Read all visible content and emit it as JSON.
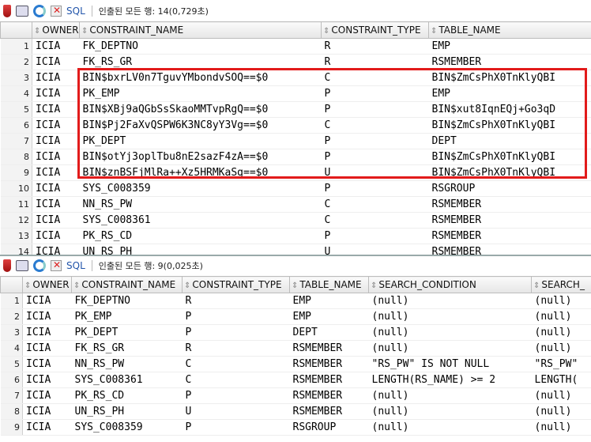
{
  "top": {
    "toolbar": {
      "sql_label": "SQL",
      "status": "인출된 모든 행: 14(0,729초)"
    },
    "columns": [
      "OWNER",
      "CONSTRAINT_NAME",
      "CONSTRAINT_TYPE",
      "TABLE_NAME"
    ],
    "rows": [
      {
        "n": "1",
        "owner": "ICIA",
        "cname": "FK_DEPTNO",
        "ctype": "R",
        "tname": "EMP"
      },
      {
        "n": "2",
        "owner": "ICIA",
        "cname": "FK_RS_GR",
        "ctype": "R",
        "tname": "RSMEMBER"
      },
      {
        "n": "3",
        "owner": "ICIA",
        "cname": "BIN$bxrLV0n7TguvYMbondvSOQ==$0",
        "ctype": "C",
        "tname": "BIN$ZmCsPhX0TnKlyQBI"
      },
      {
        "n": "4",
        "owner": "ICIA",
        "cname": "PK_EMP",
        "ctype": "P",
        "tname": "EMP"
      },
      {
        "n": "5",
        "owner": "ICIA",
        "cname": "BIN$XBj9aQGbSsSkaoMMTvpRgQ==$0",
        "ctype": "P",
        "tname": "BIN$xut8IqnEQj+Go3qD"
      },
      {
        "n": "6",
        "owner": "ICIA",
        "cname": "BIN$Pj2FaXvQSPW6K3NC8yY3Vg==$0",
        "ctype": "C",
        "tname": "BIN$ZmCsPhX0TnKlyQBI"
      },
      {
        "n": "7",
        "owner": "ICIA",
        "cname": "PK_DEPT",
        "ctype": "P",
        "tname": "DEPT"
      },
      {
        "n": "8",
        "owner": "ICIA",
        "cname": "BIN$otYj3oplTbu8nE2sazF4zA==$0",
        "ctype": "P",
        "tname": "BIN$ZmCsPhX0TnKlyQBI"
      },
      {
        "n": "9",
        "owner": "ICIA",
        "cname": "BIN$znBSFjMlRa++Xz5HRMKaSg==$0",
        "ctype": "U",
        "tname": "BIN$ZmCsPhX0TnKlyQBI"
      },
      {
        "n": "10",
        "owner": "ICIA",
        "cname": "SYS_C008359",
        "ctype": "P",
        "tname": "RSGROUP"
      },
      {
        "n": "11",
        "owner": "ICIA",
        "cname": "NN_RS_PW",
        "ctype": "C",
        "tname": "RSMEMBER"
      },
      {
        "n": "12",
        "owner": "ICIA",
        "cname": "SYS_C008361",
        "ctype": "C",
        "tname": "RSMEMBER"
      },
      {
        "n": "13",
        "owner": "ICIA",
        "cname": "PK_RS_CD",
        "ctype": "P",
        "tname": "RSMEMBER"
      },
      {
        "n": "14",
        "owner": "ICIA",
        "cname": "UN_RS_PH",
        "ctype": "U",
        "tname": "RSMEMBER"
      }
    ]
  },
  "bottom": {
    "toolbar": {
      "sql_label": "SQL",
      "status": "인출된 모든 행: 9(0,025초)"
    },
    "columns": [
      "OWNER",
      "CONSTRAINT_NAME",
      "CONSTRAINT_TYPE",
      "TABLE_NAME",
      "SEARCH_CONDITION",
      "SEARCH_"
    ],
    "rows": [
      {
        "n": "1",
        "owner": "ICIA",
        "cname": "FK_DEPTNO",
        "ctype": "R",
        "tname": "EMP",
        "cond": "(null)",
        "cond2": "(null)"
      },
      {
        "n": "2",
        "owner": "ICIA",
        "cname": "PK_EMP",
        "ctype": "P",
        "tname": "EMP",
        "cond": "(null)",
        "cond2": "(null)"
      },
      {
        "n": "3",
        "owner": "ICIA",
        "cname": "PK_DEPT",
        "ctype": "P",
        "tname": "DEPT",
        "cond": "(null)",
        "cond2": "(null)"
      },
      {
        "n": "4",
        "owner": "ICIA",
        "cname": "FK_RS_GR",
        "ctype": "R",
        "tname": "RSMEMBER",
        "cond": "(null)",
        "cond2": "(null)"
      },
      {
        "n": "5",
        "owner": "ICIA",
        "cname": "NN_RS_PW",
        "ctype": "C",
        "tname": "RSMEMBER",
        "cond": "\"RS_PW\" IS NOT NULL",
        "cond2": "\"RS_PW\""
      },
      {
        "n": "6",
        "owner": "ICIA",
        "cname": "SYS_C008361",
        "ctype": "C",
        "tname": "RSMEMBER",
        "cond": "LENGTH(RS_NAME) >= 2",
        "cond2": "LENGTH("
      },
      {
        "n": "7",
        "owner": "ICIA",
        "cname": "PK_RS_CD",
        "ctype": "P",
        "tname": "RSMEMBER",
        "cond": "(null)",
        "cond2": "(null)"
      },
      {
        "n": "8",
        "owner": "ICIA",
        "cname": "UN_RS_PH",
        "ctype": "U",
        "tname": "RSMEMBER",
        "cond": "(null)",
        "cond2": "(null)"
      },
      {
        "n": "9",
        "owner": "ICIA",
        "cname": "SYS_C008359",
        "ctype": "P",
        "tname": "RSGROUP",
        "cond": "(null)",
        "cond2": "(null)"
      }
    ]
  }
}
